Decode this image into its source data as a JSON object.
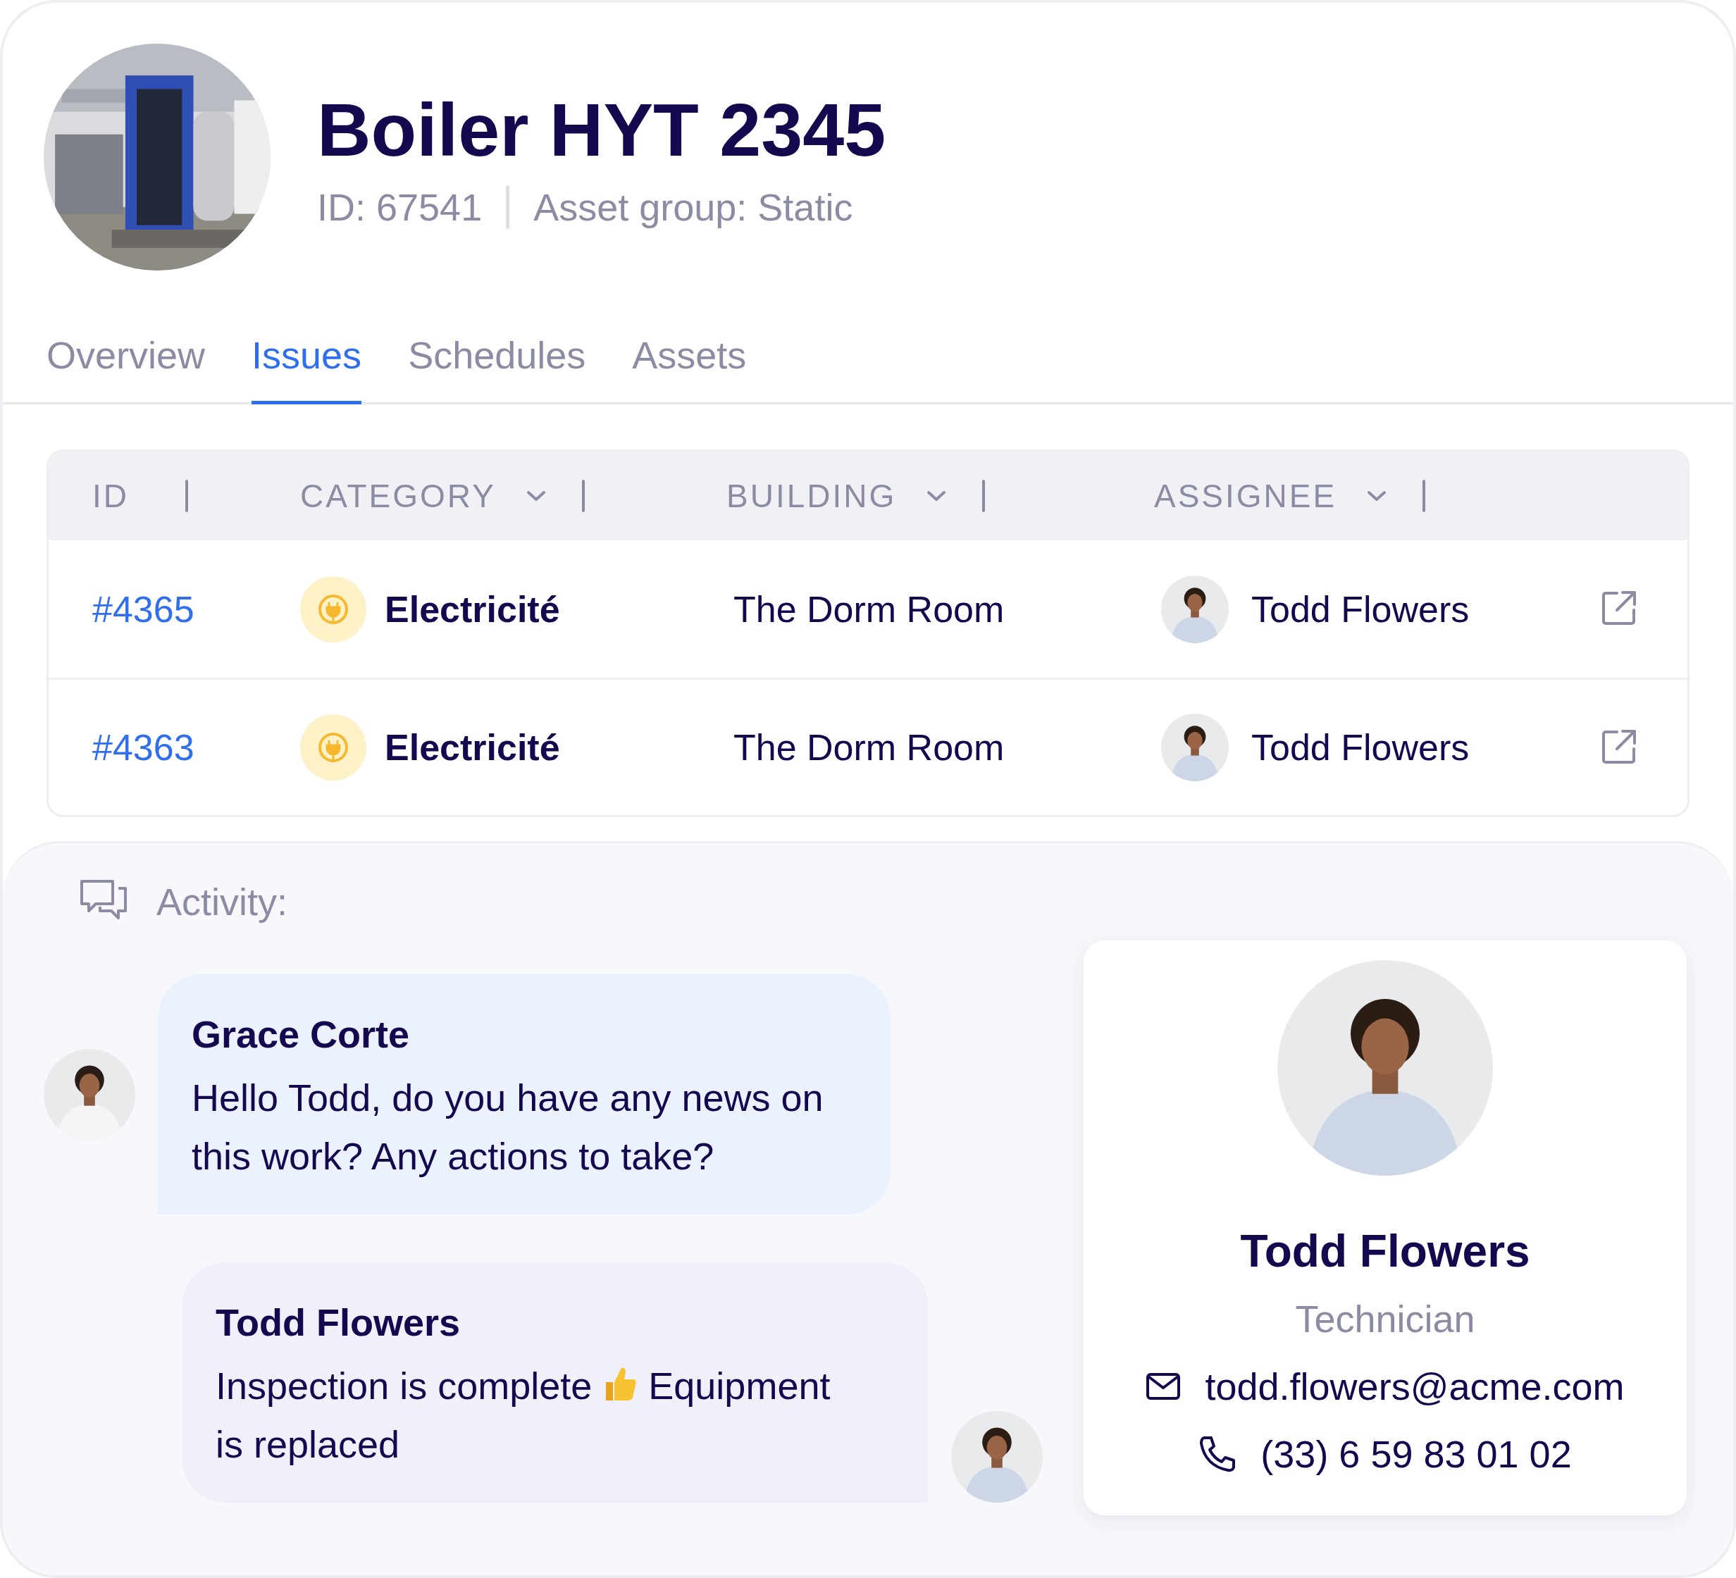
{
  "asset": {
    "title": "Boiler HYT 2345",
    "id_text": "ID: 67541",
    "group_text": "Asset group: Static"
  },
  "tabs": [
    {
      "label": "Overview",
      "selected": false
    },
    {
      "label": "Issues",
      "selected": true
    },
    {
      "label": "Schedules",
      "selected": false
    },
    {
      "label": "Assets",
      "selected": false
    }
  ],
  "table": {
    "columns": [
      {
        "label": "ID",
        "dropdown": false
      },
      {
        "label": "CATEGORY",
        "dropdown": true
      },
      {
        "label": "BUILDING",
        "dropdown": true
      },
      {
        "label": "ASSIGNEE",
        "dropdown": true
      }
    ],
    "rows": [
      {
        "id": "#4365",
        "category": "Electricité",
        "building": "The Dorm Room",
        "assignee": "Todd Flowers"
      },
      {
        "id": "#4363",
        "category": "Electricité",
        "building": "The Dorm Room",
        "assignee": "Todd Flowers"
      }
    ]
  },
  "activity": {
    "label": "Activity:",
    "messages": [
      {
        "author": "Grace Corte",
        "kind": "incoming",
        "content": [
          {
            "kind": "text",
            "text": "Hello Todd, do you have any news on this work? Any actions to take?"
          }
        ]
      },
      {
        "author": "Todd Flowers",
        "kind": "outgoing",
        "content": [
          {
            "kind": "text",
            "text": "Inspection is complete"
          },
          {
            "kind": "thumbs_up"
          },
          {
            "kind": "text",
            "text": "Equipment"
          },
          {
            "kind": "text",
            "text": "is replaced"
          }
        ]
      }
    ]
  },
  "profile": {
    "name": "Todd Flowers",
    "role": "Technician",
    "email": "todd.flowers@acme.com",
    "phone": "(33) 6 59 83 01 02"
  }
}
